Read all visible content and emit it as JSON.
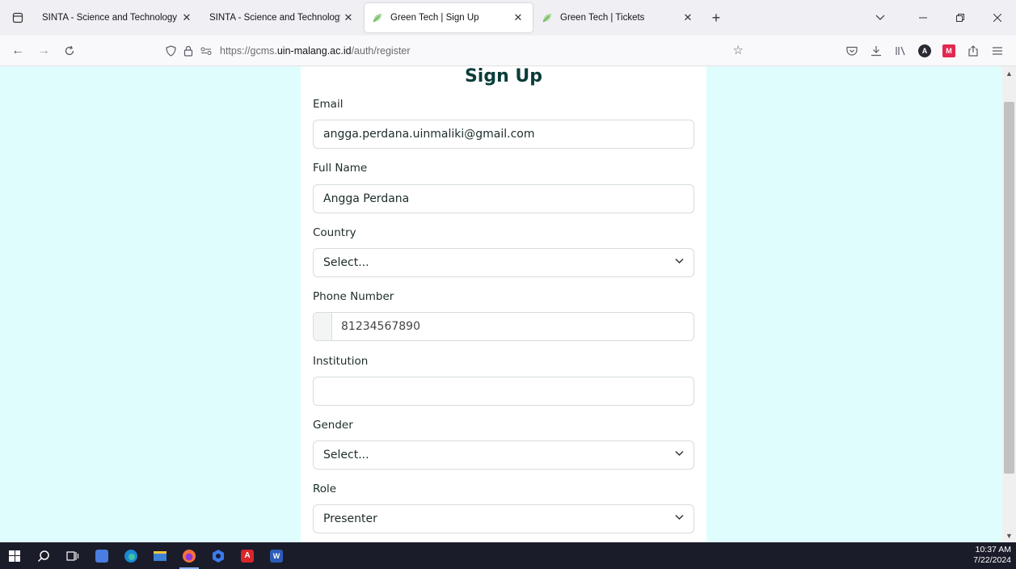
{
  "browser": {
    "tabs": [
      {
        "title": "SINTA - Science and Technology Ind",
        "active": false
      },
      {
        "title": "SINTA - Science and Technology Ind",
        "active": false
      },
      {
        "title": "Green Tech | Sign Up",
        "active": true
      },
      {
        "title": "Green Tech | Tickets",
        "active": false
      }
    ],
    "url_prefix": "https://gcms.",
    "url_domain": "uin-malang.ac.id",
    "url_path": "/auth/register"
  },
  "form": {
    "title": "Sign Up",
    "email_label": "Email",
    "email_value": "angga.perdana.uinmaliki@gmail.com",
    "fullname_label": "Full Name",
    "fullname_value": "Angga Perdana",
    "country_label": "Country",
    "country_value": "Select...",
    "phone_label": "Phone Number",
    "phone_value": "81234567890",
    "institution_label": "Institution",
    "institution_value": "",
    "gender_label": "Gender",
    "gender_value": "Select...",
    "role_label": "Role",
    "role_value": "Presenter"
  },
  "taskbar": {
    "time": "10:37 AM",
    "date": "7/22/2024"
  },
  "colors": {
    "page_bg": "#e0fdfd",
    "title": "#0a3d3a",
    "taskbar": "#1b1c2a"
  }
}
